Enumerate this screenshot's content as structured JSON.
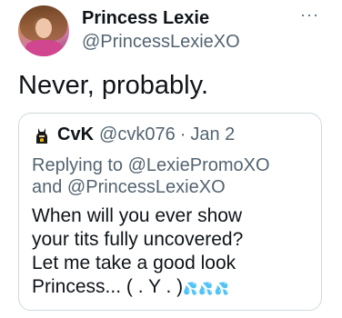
{
  "author": {
    "display_name": "Princess Lexie",
    "handle": "@PrincessLexieXO"
  },
  "more_label": "···",
  "tweet_text": "Never, probably.",
  "quoted": {
    "display_name": "CvK",
    "handle": "@cvk076",
    "separator": "·",
    "date": "Jan 2",
    "reply_line1": "Replying to @LexiePromoXO",
    "reply_line2": "and @PrincessLexieXO",
    "body_lines": [
      "When will you ever show",
      "your tits fully uncovered?",
      "Let me take a good look",
      "Princess... ( . Y . )"
    ],
    "emoji_tail": "💦💦💦",
    "avatar_icon": "batman-icon"
  }
}
